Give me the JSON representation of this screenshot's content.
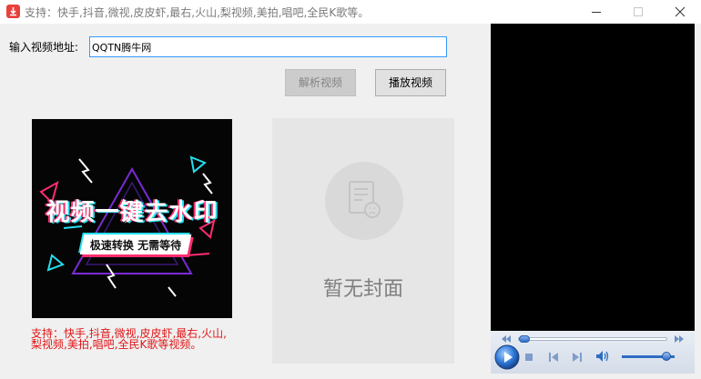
{
  "window": {
    "title": "支持：快手,抖音,微视,皮皮虾,最右,火山,梨视频,美拍,唱吧,全民K歌等。"
  },
  "form": {
    "url_label": "输入视频地址:",
    "url_value": "QQTN腾牛网",
    "parse_button_label": "解析视频",
    "parse_button_enabled": false,
    "play_button_label": "播放视频"
  },
  "poster": {
    "headline": "视频一键去水印",
    "subline": "极速转换 无需等待"
  },
  "support_note": "支持：快手,抖音,微视,皮皮虾,最右,火山,梨视频,美拍,唱吧,全民K歌等视频。",
  "cover": {
    "placeholder_text": "暂无封面",
    "icon": "document-sad-icon"
  },
  "player": {
    "seek_progress": 0.0,
    "volume_level": 0.5,
    "controls": [
      "rewind-icon",
      "fast-forward-icon",
      "play-icon",
      "stop-icon",
      "previous-icon",
      "next-icon",
      "volume-icon"
    ]
  },
  "colors": {
    "accent_border": "#3399ff",
    "support_text": "#e11414",
    "app_icon": "#e8413c",
    "poster_pink": "#ff2d6f",
    "poster_cyan": "#24e0f0"
  }
}
